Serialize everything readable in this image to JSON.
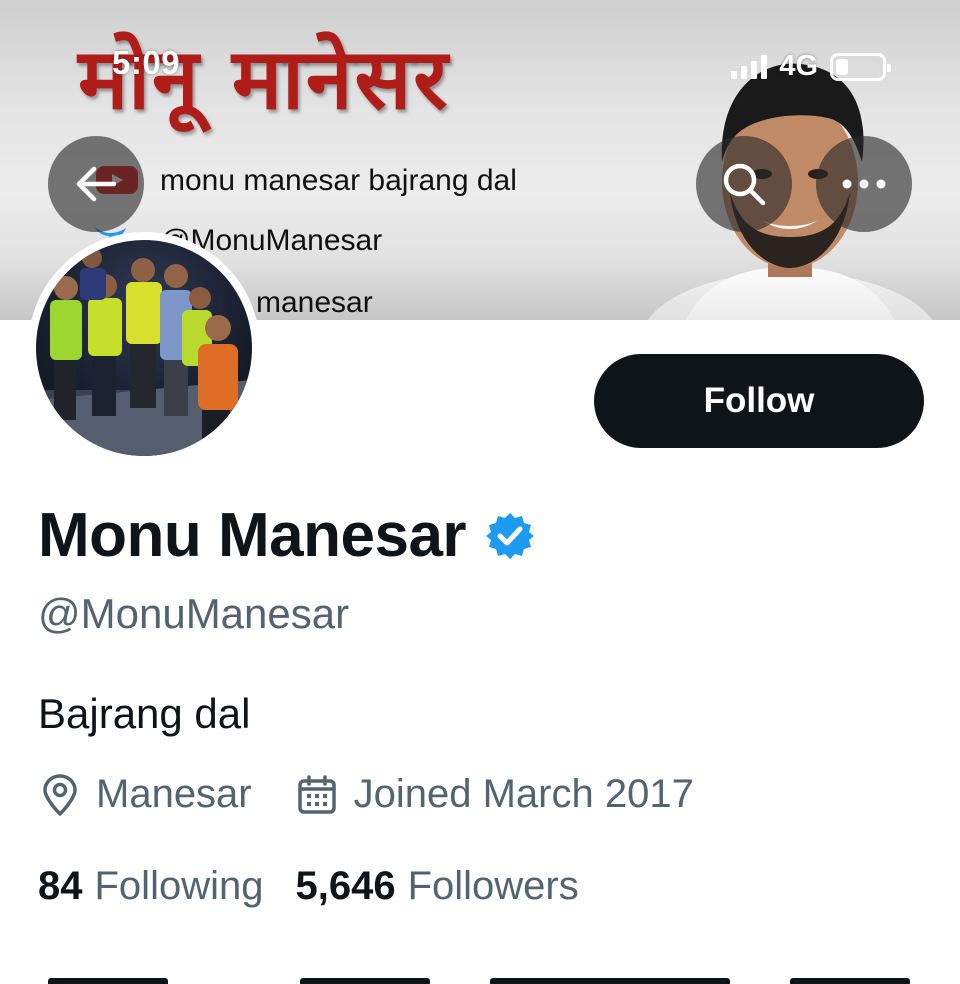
{
  "status_bar": {
    "time": "5:09",
    "network": "4G",
    "battery_level": 0.2
  },
  "banner": {
    "hindi_title": "मोनू मानेसर",
    "youtube_text": "monu manesar bajrang dal",
    "twitter_text": "@MonuManesar",
    "third_text": "manesar"
  },
  "nav": {
    "back_icon": "arrow-left-icon",
    "search_icon": "search-icon",
    "more_icon": "more-dots-icon"
  },
  "profile": {
    "follow_label": "Follow",
    "name": "Monu Manesar",
    "verified": true,
    "verified_color": "#1d9bf0",
    "handle": "@MonuManesar",
    "bio": "Bajrang dal",
    "location": "Manesar",
    "joined": "Joined March 2017",
    "following_count": "84",
    "following_label": "Following",
    "followers_count": "5,646",
    "followers_label": "Followers"
  },
  "colors": {
    "text_primary": "#0f1419",
    "text_secondary": "#536471",
    "button_dark": "#0f1419",
    "banner_title": "#b01d18"
  }
}
